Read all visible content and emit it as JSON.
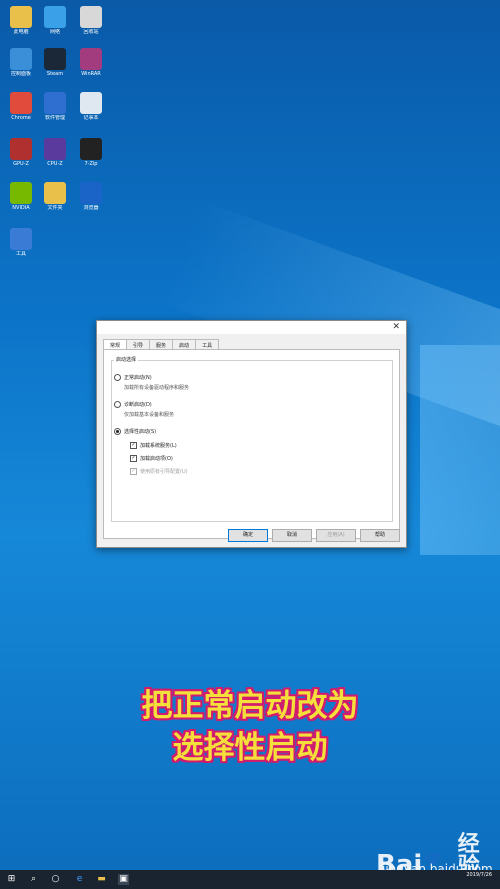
{
  "desktop_icons": [
    {
      "label": "此电脑",
      "color": "#e8c04a"
    },
    {
      "label": "网络",
      "color": "#3aa0e8"
    },
    {
      "label": "回收站",
      "color": "#d8d8d8"
    },
    {
      "label": "控制面板",
      "color": "#3a8fd8"
    },
    {
      "label": "Steam",
      "color": "#1b2838"
    },
    {
      "label": "WinRAR",
      "color": "#a33c7e"
    },
    {
      "label": "Chrome",
      "color": "#e04b3c"
    },
    {
      "label": "软件管理",
      "color": "#2f6fcf"
    },
    {
      "label": "记事本",
      "color": "#dfe8f0"
    },
    {
      "label": "GPU-Z",
      "color": "#b03030"
    },
    {
      "label": "CPU-Z",
      "color": "#5b3a9e"
    },
    {
      "label": "7-Zip",
      "color": "#222222"
    },
    {
      "label": "NVIDIA",
      "color": "#76b900"
    },
    {
      "label": "文件夹",
      "color": "#e8c04a"
    },
    {
      "label": "浏览器",
      "color": "#1a64c8"
    },
    {
      "label": "工具",
      "color": "#3a7bd5"
    }
  ],
  "dialog": {
    "tabs": [
      "常规",
      "引导",
      "服务",
      "启动",
      "工具"
    ],
    "group_title": "启动选择",
    "options": [
      {
        "label": "正常启动(N)",
        "desc": "加载所有设备驱动程序和服务"
      },
      {
        "label": "诊断启动(D)",
        "desc": "仅加载基本设备和服务"
      },
      {
        "label": "选择性启动(S)"
      }
    ],
    "checks": [
      "加载系统服务(L)",
      "加载启动项(O)",
      "使用原有引导配置(U)"
    ],
    "buttons": {
      "ok": "确定",
      "cancel": "取消",
      "apply": "应用(A)",
      "help": "帮助"
    }
  },
  "caption": {
    "line1": "把正常启动改为",
    "line2": "选择性启动"
  },
  "watermark": {
    "logo": "Bai",
    "suffix": "经验",
    "url": "jingyan.baidu.com"
  },
  "taskbar": {
    "date": "2019/7/26"
  }
}
